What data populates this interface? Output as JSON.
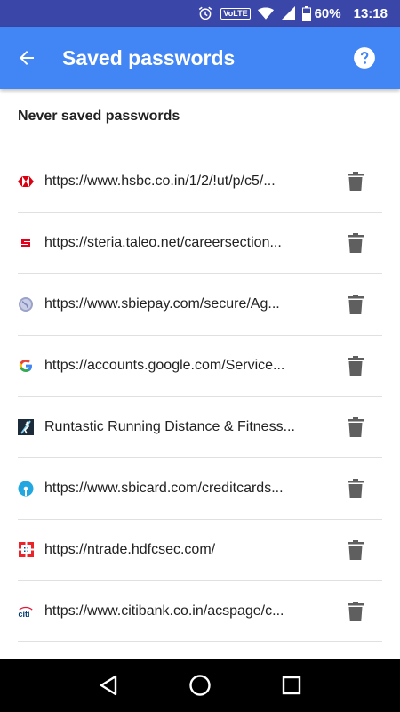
{
  "status_bar": {
    "battery": "60%",
    "time": "13:18",
    "volte": "VoLTE"
  },
  "app_bar": {
    "title": "Saved passwords"
  },
  "section": {
    "title": "Never saved passwords"
  },
  "never_saved": [
    {
      "text": "https://www.hsbc.co.in/1/2/!ut/p/c5/...",
      "icon": "hsbc-favicon"
    },
    {
      "text": "https://steria.taleo.net/careersection...",
      "icon": "steria-favicon"
    },
    {
      "text": "https://www.sbiepay.com/secure/Ag...",
      "icon": "globe-favicon"
    },
    {
      "text": "https://accounts.google.com/Service...",
      "icon": "google-favicon"
    },
    {
      "text": "Runtastic Running Distance & Fitness...",
      "icon": "runtastic-favicon"
    },
    {
      "text": "https://www.sbicard.com/creditcards...",
      "icon": "sbi-favicon"
    },
    {
      "text": "https://ntrade.hdfcsec.com/",
      "icon": "hdfc-favicon"
    },
    {
      "text": "https://www.citibank.co.in/acspage/c...",
      "icon": "citi-favicon"
    }
  ],
  "colors": {
    "app_bar": "#4285f4",
    "status_bar": "#3a47a8",
    "nav_bar": "#000000"
  }
}
